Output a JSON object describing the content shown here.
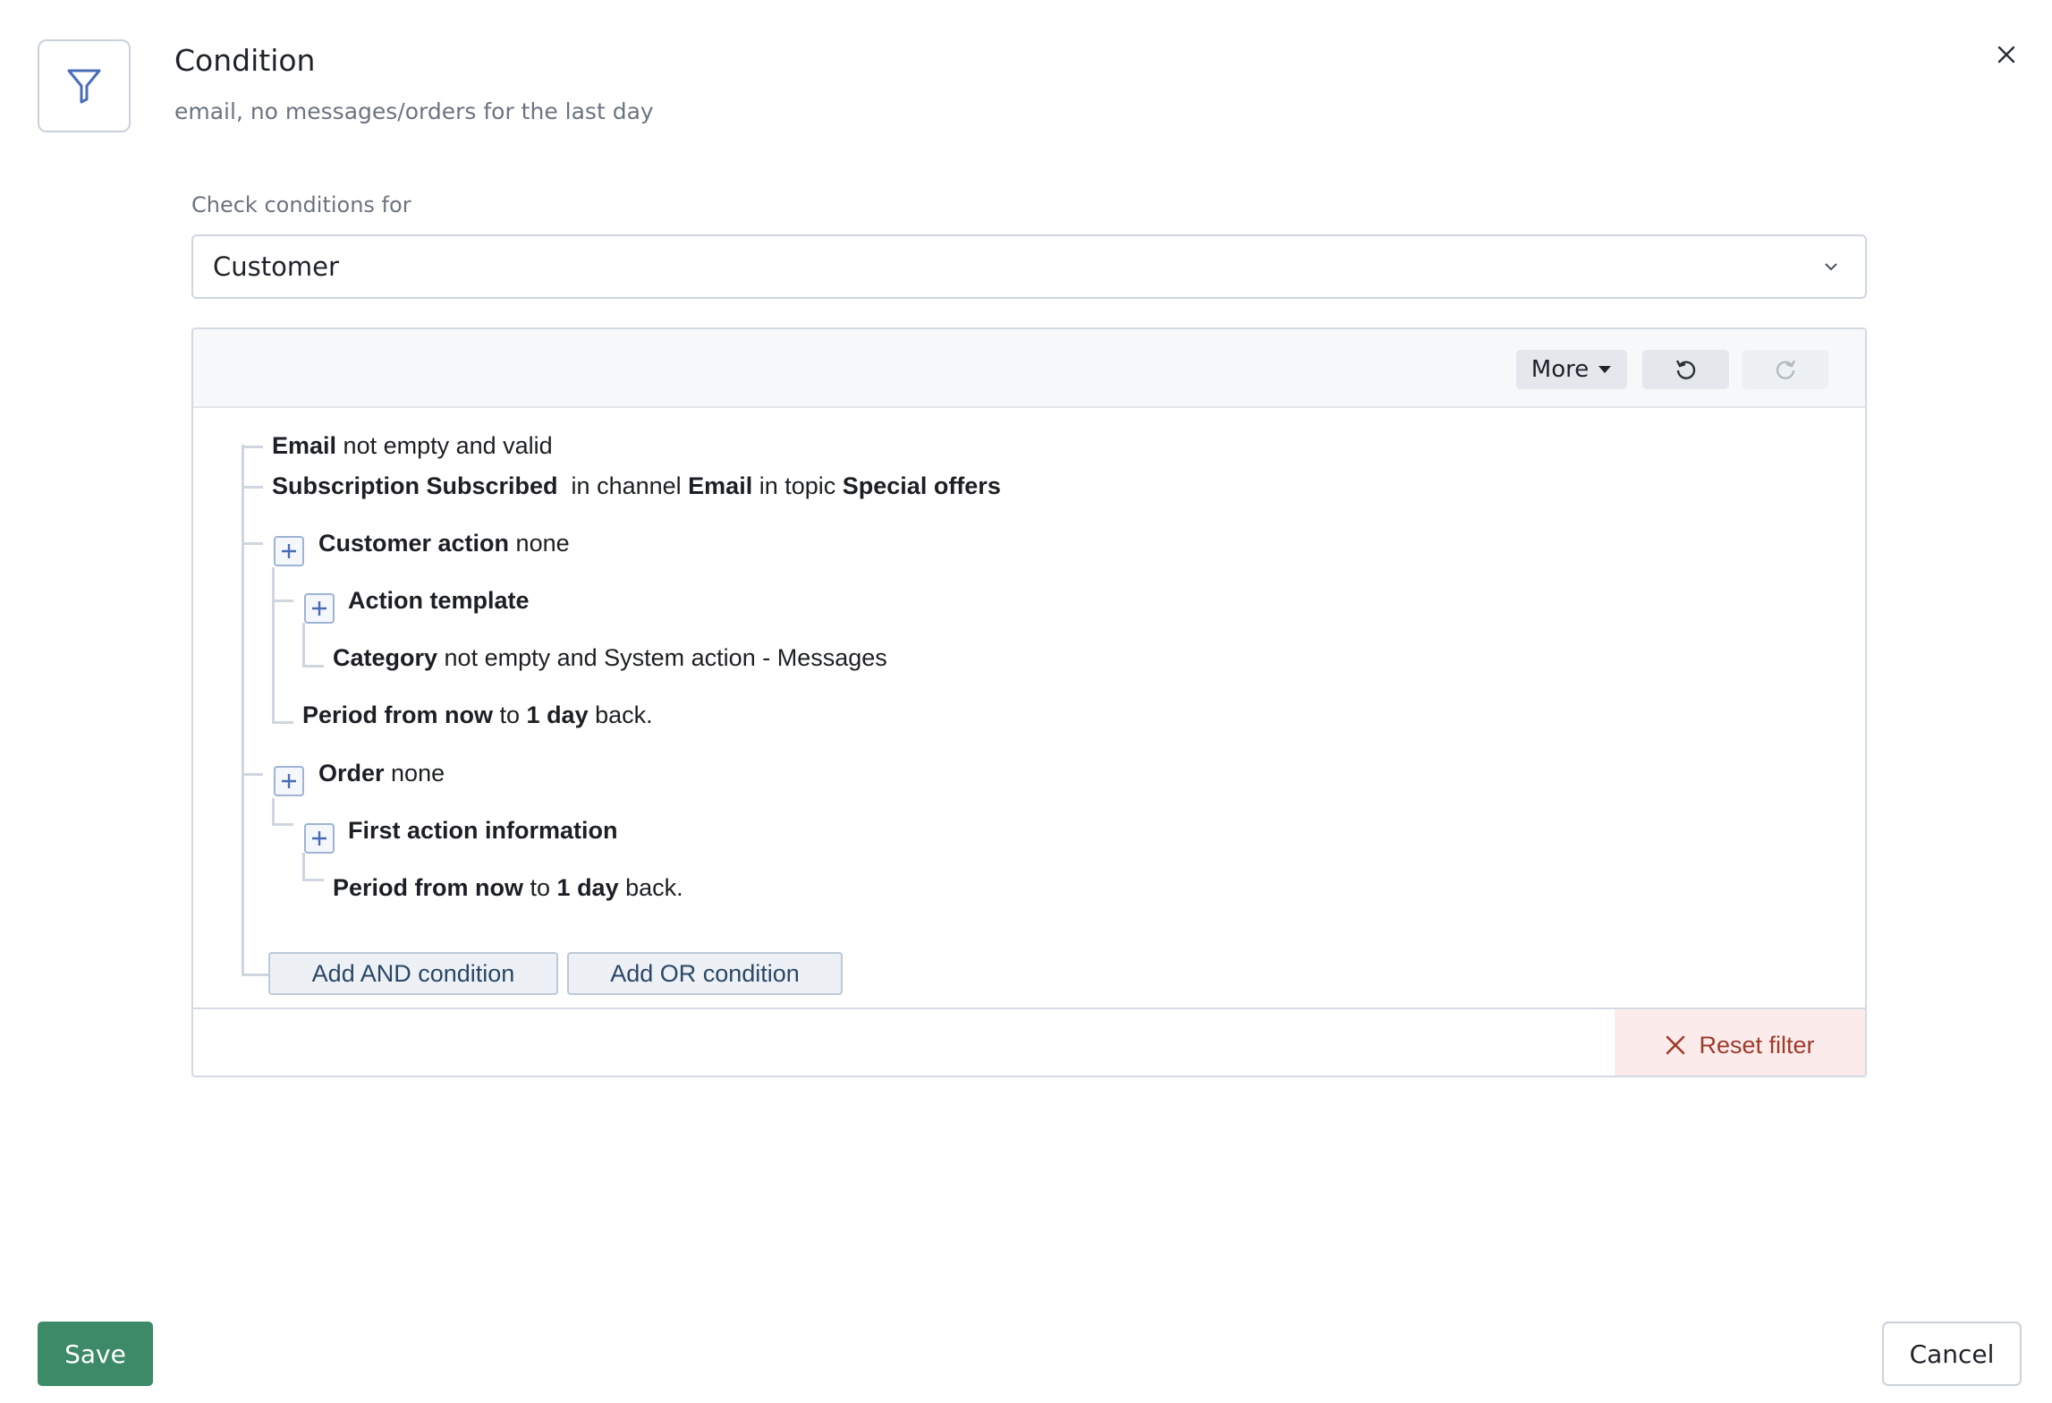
{
  "header": {
    "icon": "filter-icon",
    "title": "Condition",
    "subtitle": "email, no messages/orders for the last day",
    "close_icon": "close-icon"
  },
  "check_conditions": {
    "label": "Check conditions for",
    "selected": "Customer"
  },
  "toolbar": {
    "more_label": "More",
    "undo_icon": "undo-icon",
    "redo_icon": "redo-icon"
  },
  "conditions": [
    {
      "parts": [
        {
          "b": "Email"
        },
        {
          "t": " not empty and valid"
        }
      ]
    },
    {
      "parts": [
        {
          "b": "Subscription Subscribed"
        },
        {
          "t": "  in channel "
        },
        {
          "b": "Email"
        },
        {
          "t": " in topic "
        },
        {
          "b": "Special offers"
        }
      ]
    },
    {
      "parts": [
        {
          "b": "Customer action"
        },
        {
          "t": " none"
        }
      ]
    },
    {
      "parts": [
        {
          "b": "Action template"
        }
      ]
    },
    {
      "parts": [
        {
          "b": "Category"
        },
        {
          "t": " not empty and System action - Messages"
        }
      ]
    },
    {
      "parts": [
        {
          "b": "Period from now"
        },
        {
          "t": " to "
        },
        {
          "b": "1 day"
        },
        {
          "t": " back."
        }
      ]
    },
    {
      "parts": [
        {
          "b": "Order"
        },
        {
          "t": " none"
        }
      ]
    },
    {
      "parts": [
        {
          "b": "First action information"
        }
      ]
    },
    {
      "parts": [
        {
          "b": "Period from now"
        },
        {
          "t": " to "
        },
        {
          "b": "1 day"
        },
        {
          "t": " back."
        }
      ]
    }
  ],
  "actions": {
    "add_and": "Add AND condition",
    "add_or": "Add OR condition",
    "reset": "Reset filter"
  },
  "footer": {
    "save": "Save",
    "cancel": "Cancel"
  },
  "colors": {
    "save_bg": "#3c8a67",
    "reset_text": "#a03a2c",
    "reset_bg": "#fbeceb",
    "icon_blue": "#4a6cb8"
  }
}
